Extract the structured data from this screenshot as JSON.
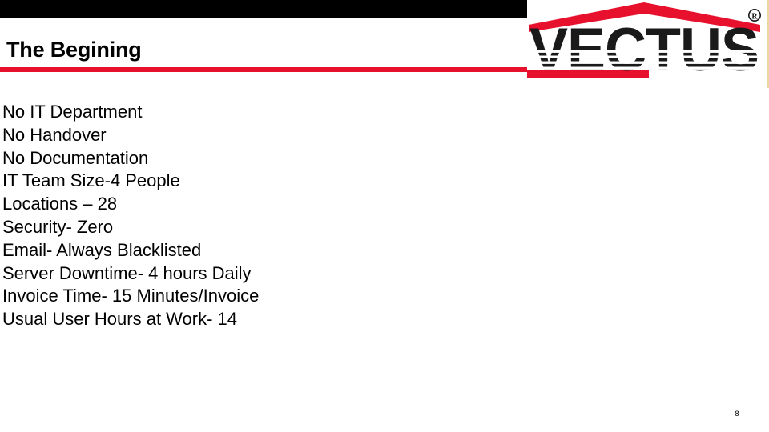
{
  "slide": {
    "title": "The Begining",
    "page_number": "8",
    "footer_clipped_text": "",
    "body_lines": [
      {
        "text": "No IT Department"
      },
      {
        "text": "No Handover"
      },
      {
        "text": "No Documentation"
      },
      {
        "text": "IT Team Size-4 People"
      },
      {
        "text": "Locations – 28"
      },
      {
        "text": "Security- Zero"
      },
      {
        "text": "Email- Always Blacklisted"
      },
      {
        "text": "Server Downtime- 4 hours Daily"
      },
      {
        "text": "Invoice Time- 15 Minutes/Invoice"
      },
      {
        "text": "Usual User Hours at Work- 14"
      }
    ]
  },
  "logo": {
    "wordmark": "VECTUS",
    "trademark_symbol": "®",
    "roof_shape": "red-chevron-roof",
    "colors": {
      "red": "#E8112D",
      "black": "#1A1A1A",
      "border": "#E8D9A0"
    }
  },
  "decor": {
    "top_bar_color": "#000000",
    "title_rule_color": "#E8112D",
    "background_color": "#FFFFFF"
  }
}
